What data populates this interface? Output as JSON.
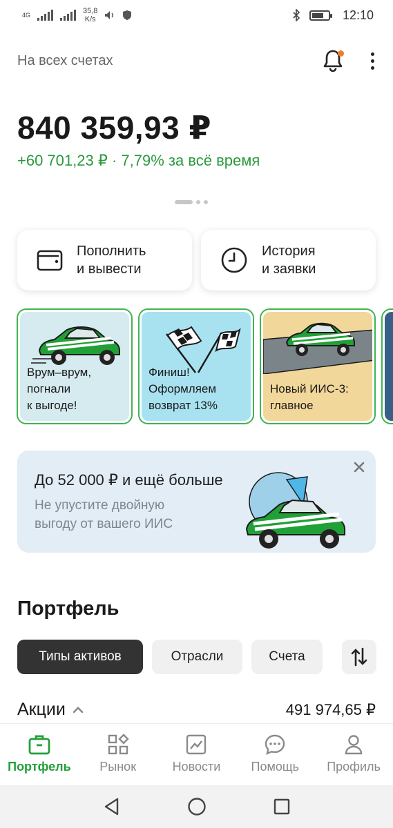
{
  "status_bar": {
    "network": "4G",
    "speed_value": "35,8",
    "speed_unit": "K/s",
    "time": "12:10"
  },
  "header": {
    "accounts_label": "На всех счетах"
  },
  "balance": {
    "total": "840 359,93 ₽",
    "profit": "+60 701,23 ₽ · 7,79% за всё время"
  },
  "actions": [
    {
      "label": "Пополнить\nи вывести",
      "icon": "wallet-icon"
    },
    {
      "label": "История\nи заявки",
      "icon": "clock-icon"
    }
  ],
  "stories": [
    {
      "title": "Врум–врум,\nпогнали\nк выгоде!",
      "bg": "#d6ebef"
    },
    {
      "title": "Финиш!\nОформляем\nвозврат 13%",
      "bg": "#a8e2f1"
    },
    {
      "title": "Новый ИИС-3:\nглавное",
      "bg": "#f2d79a"
    }
  ],
  "promo": {
    "title": "До 52 000 ₽ и ещё больше",
    "subtitle": "Не упустите двойную\nвыгоду от вашего ИИС"
  },
  "portfolio": {
    "title": "Портфель",
    "filters": [
      "Типы активов",
      "Отрасли",
      "Счета"
    ],
    "active_filter": "Типы активов",
    "stocks_label": "Акции",
    "stocks_value": "491 974,65 ₽"
  },
  "bottom_nav": [
    {
      "label": "Портфель",
      "icon": "briefcase-icon",
      "active": true
    },
    {
      "label": "Рынок",
      "icon": "market-icon",
      "active": false
    },
    {
      "label": "Новости",
      "icon": "news-icon",
      "active": false
    },
    {
      "label": "Помощь",
      "icon": "chat-icon",
      "active": false
    },
    {
      "label": "Профиль",
      "icon": "profile-icon",
      "active": false
    }
  ],
  "colors": {
    "accent_green": "#21a038",
    "profit_green": "#2a9a3c",
    "notification_dot": "#f07c28",
    "promo_bg": "#e3edf6"
  }
}
